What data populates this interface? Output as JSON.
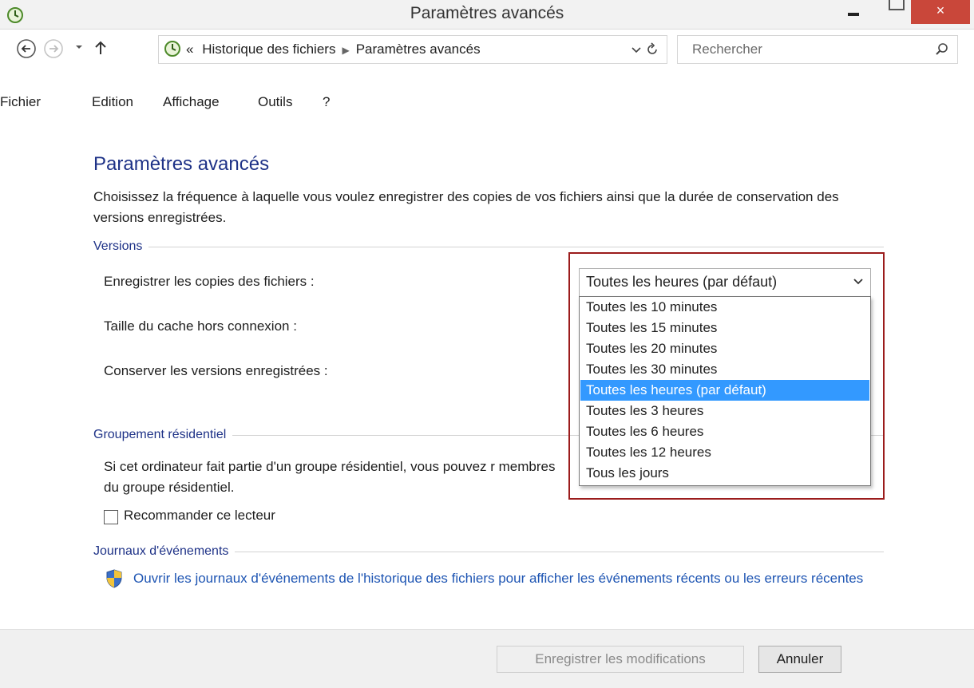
{
  "window": {
    "title": "Paramètres avancés",
    "close_glyph": "×"
  },
  "navigation": {
    "breadcrumb_prefix": "«",
    "breadcrumb": [
      "Historique des fichiers",
      "Paramètres avancés"
    ],
    "search_placeholder": "Rechercher"
  },
  "menu": [
    "Fichier",
    "Edition",
    "Affichage",
    "Outils",
    "?"
  ],
  "page": {
    "title": "Paramètres avancés",
    "description": "Choisissez la fréquence à laquelle vous voulez enregistrer des copies de vos fichiers ainsi que la durée de conservation des versions enregistrées."
  },
  "versions": {
    "heading": "Versions",
    "save_copies_label": "Enregistrer les copies des fichiers :",
    "cache_size_label": "Taille du cache hors connexion :",
    "keep_versions_label": "Conserver les versions enregistrées :",
    "frequency_selected": "Toutes les heures (par défaut)",
    "frequency_options": [
      "Toutes les 10 minutes",
      "Toutes les 15 minutes",
      "Toutes les 20 minutes",
      "Toutes les 30 minutes",
      "Toutes les heures (par défaut)",
      "Toutes les 3 heures",
      "Toutes les 6 heures",
      "Toutes les 12 heures",
      "Tous les jours"
    ],
    "selected_index": 4
  },
  "homegroup": {
    "heading": "Groupement résidentiel",
    "text": "Si cet ordinateur fait partie d'un groupe résidentiel, vous pouvez r membres du groupe résidentiel.",
    "checkbox_label": "Recommander ce lecteur",
    "checkbox_checked": false
  },
  "events": {
    "heading": "Journaux d'événements",
    "link_text": "Ouvrir les journaux d'événements de l'historique des fichiers pour afficher les événements récents ou les erreurs récentes"
  },
  "footer": {
    "save_label": "Enregistrer les modifications",
    "cancel_label": "Annuler"
  },
  "colors": {
    "heading_blue": "#1e3287",
    "link_blue": "#1e55b3",
    "selection_blue": "#3399ff",
    "close_red": "#c9473a",
    "highlight_red": "#9b1c1c"
  }
}
